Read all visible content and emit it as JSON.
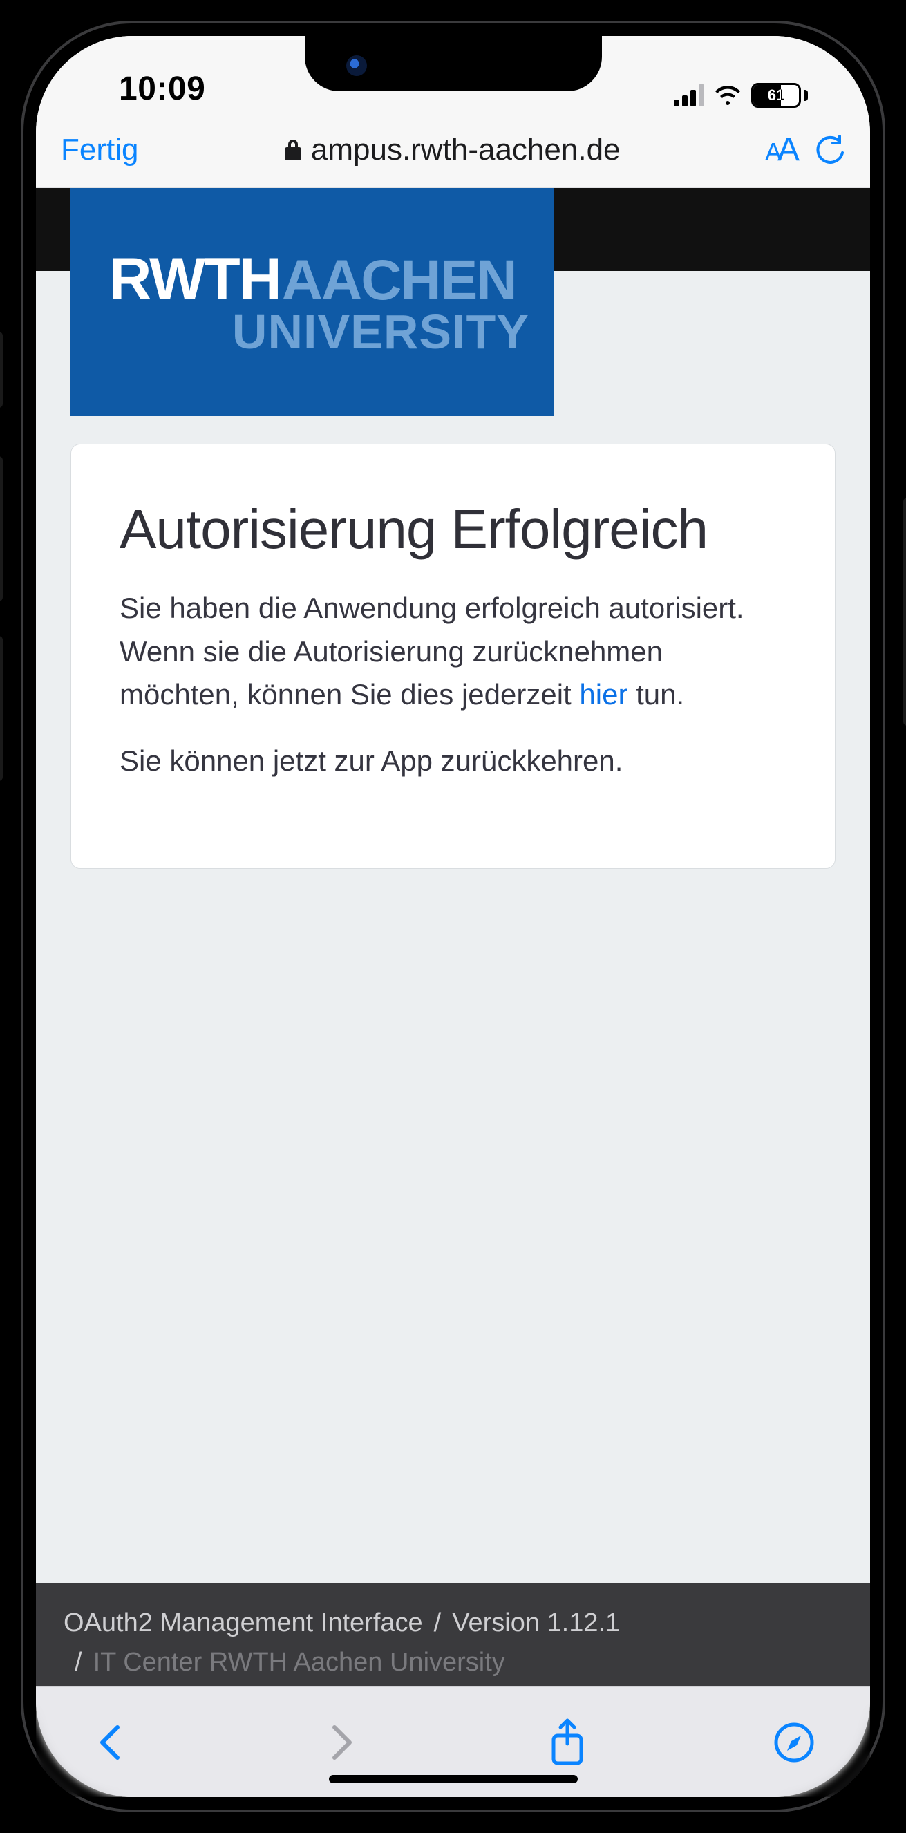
{
  "status": {
    "time": "10:09",
    "battery_percent": "61"
  },
  "browser_bar": {
    "done_label": "Fertig",
    "url_display": "ampus.rwth-aachen.de"
  },
  "logo": {
    "l1": "RWTH",
    "l2": "AACHEN",
    "l3": "UNIVERSITY"
  },
  "card": {
    "title": "Autorisierung Erfolgreich",
    "p1_before": "Sie haben die Anwendung erfolgreich autorisiert. Wenn sie die Autorisierung zurücknehmen möchten, können Sie dies jederzeit ",
    "p1_link": "hier",
    "p1_after": " tun.",
    "p2": "Sie können jetzt zur App zurückkehren."
  },
  "footer": {
    "app": "OAuth2 Management Interface",
    "version": "Version 1.12.1",
    "org": "IT Center RWTH Aachen University"
  }
}
